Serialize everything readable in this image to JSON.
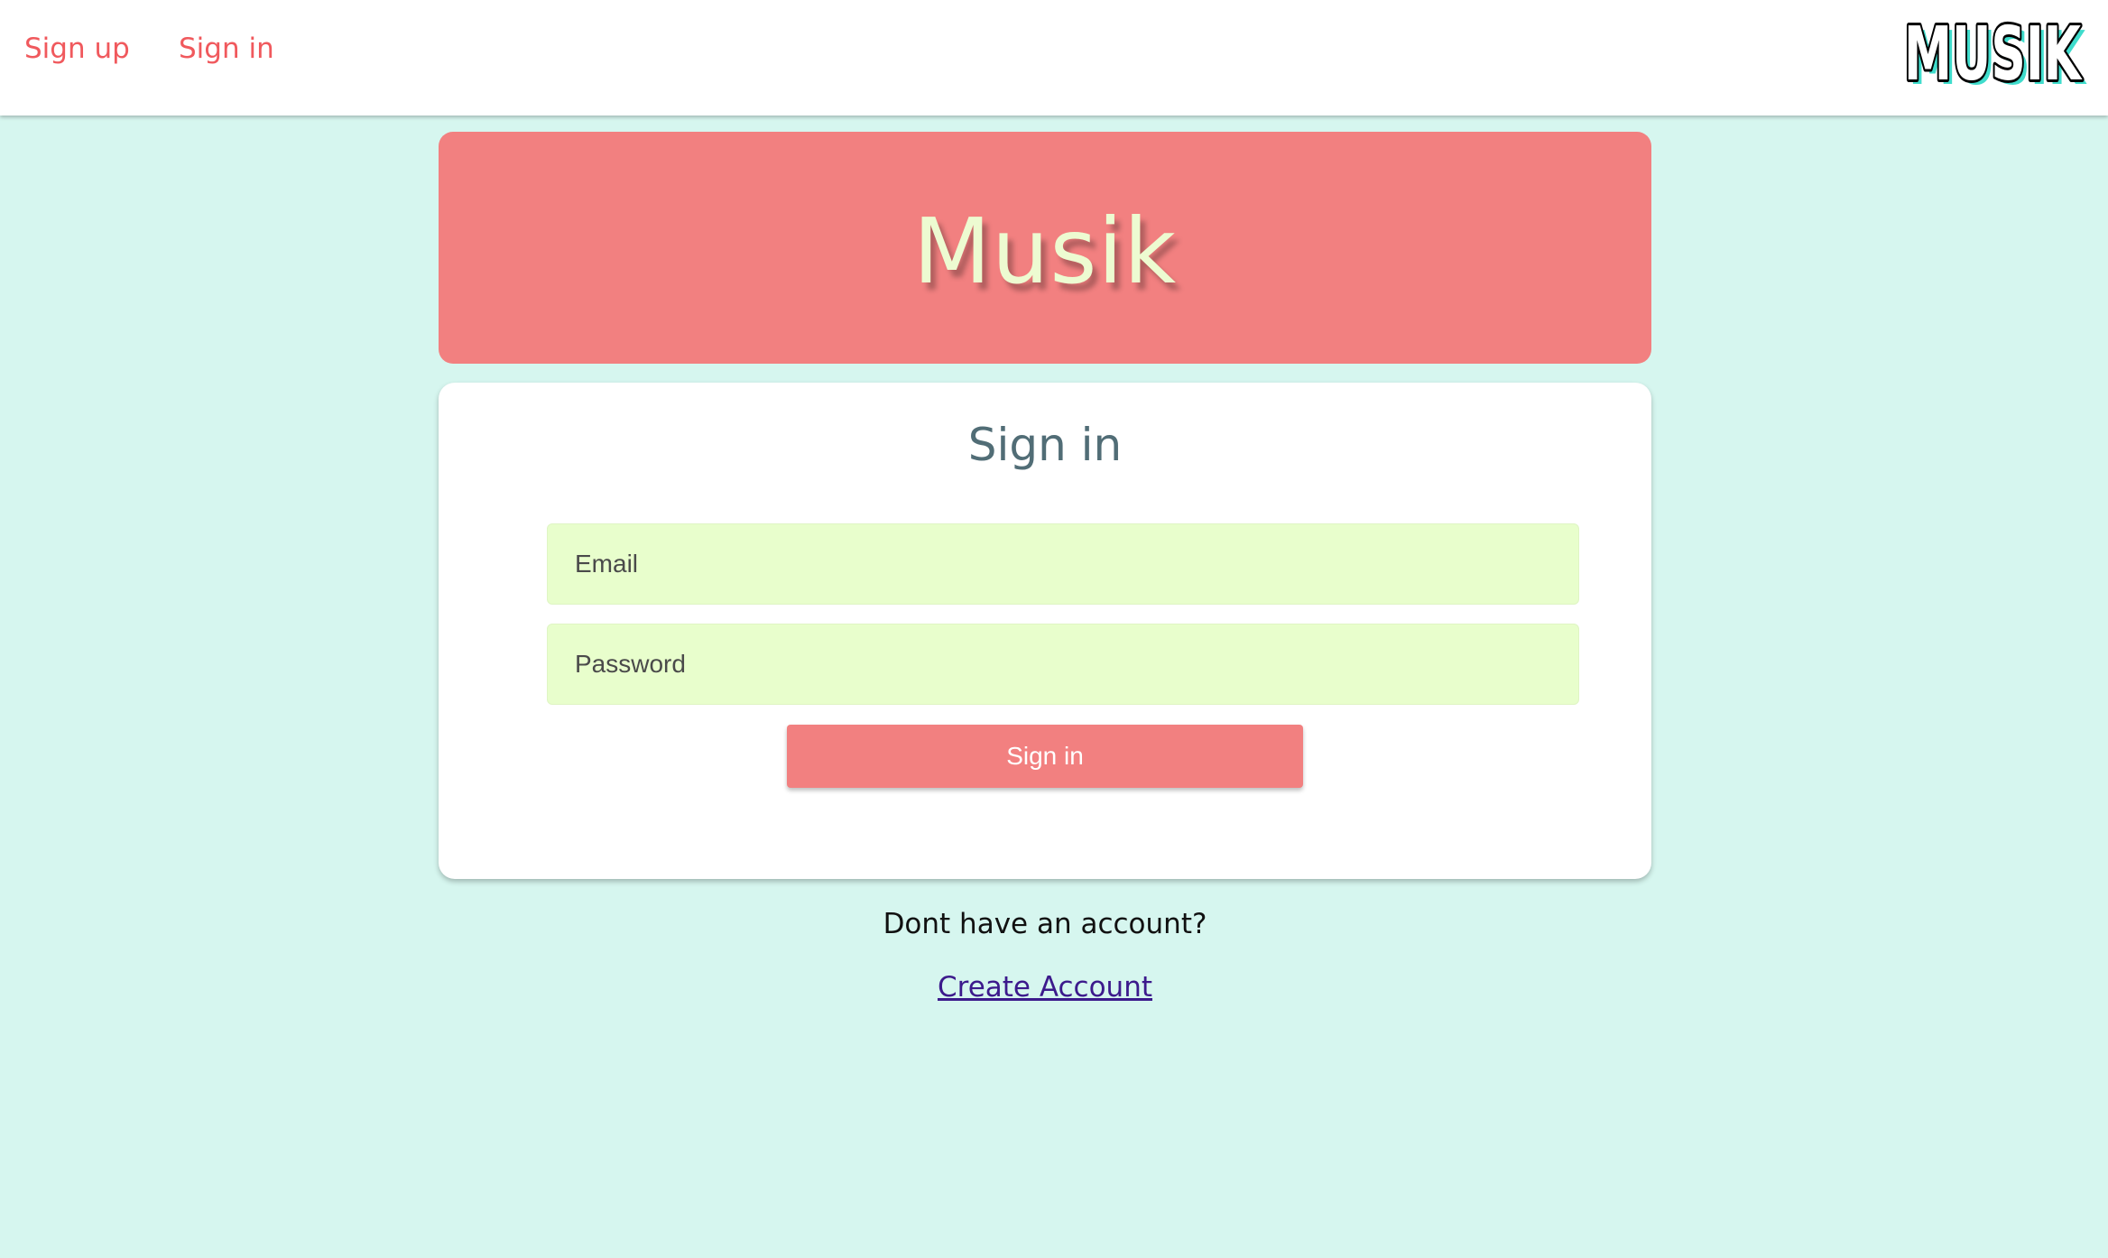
{
  "nav": {
    "signup_label": "Sign up",
    "signin_label": "Sign in",
    "logo_text": "MUSIK"
  },
  "hero": {
    "title": "Musik"
  },
  "signin_form": {
    "title": "Sign in",
    "email_placeholder": "Email",
    "password_placeholder": "Password",
    "submit_label": "Sign in"
  },
  "footer": {
    "prompt": "Dont have an account?",
    "create_account_label": "Create Account"
  },
  "colors": {
    "background": "#d6f6ef",
    "accent": "#f28080",
    "nav_link": "#f0595d",
    "input_bg": "#e8fecc",
    "hero_text": "#edfbd1",
    "link": "#3c1a8c"
  }
}
